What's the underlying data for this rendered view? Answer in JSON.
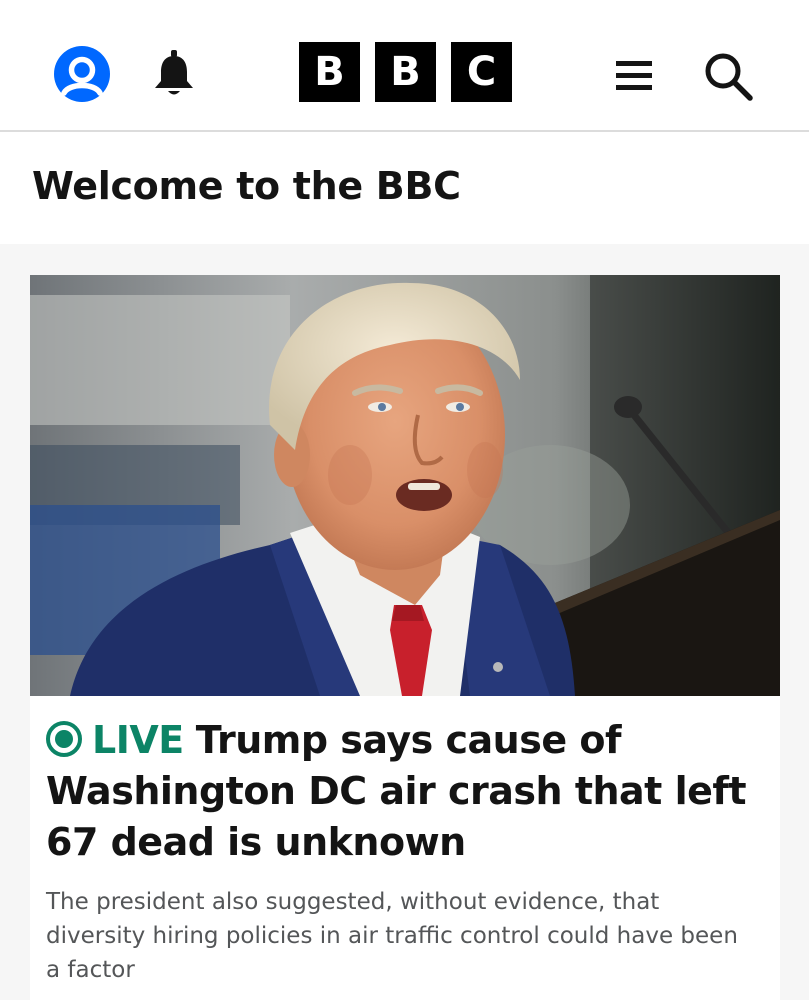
{
  "header": {
    "logo_letters": [
      "B",
      "B",
      "C"
    ],
    "account_icon": "user-account-icon",
    "notifications_icon": "bell-icon",
    "menu_icon": "hamburger-menu-icon",
    "search_icon": "search-icon",
    "account_color": "#0068ff"
  },
  "welcome": {
    "title": "Welcome to the BBC"
  },
  "lead_story": {
    "live_label": "LIVE",
    "live_icon": "live-indicator-icon",
    "live_color": "#0c8466",
    "headline": "Trump says cause of Washington DC air crash that left 67 dead is unknown",
    "summary": "The president also suggested, without evidence, that diversity hiring policies in air traffic control could have been a factor"
  }
}
